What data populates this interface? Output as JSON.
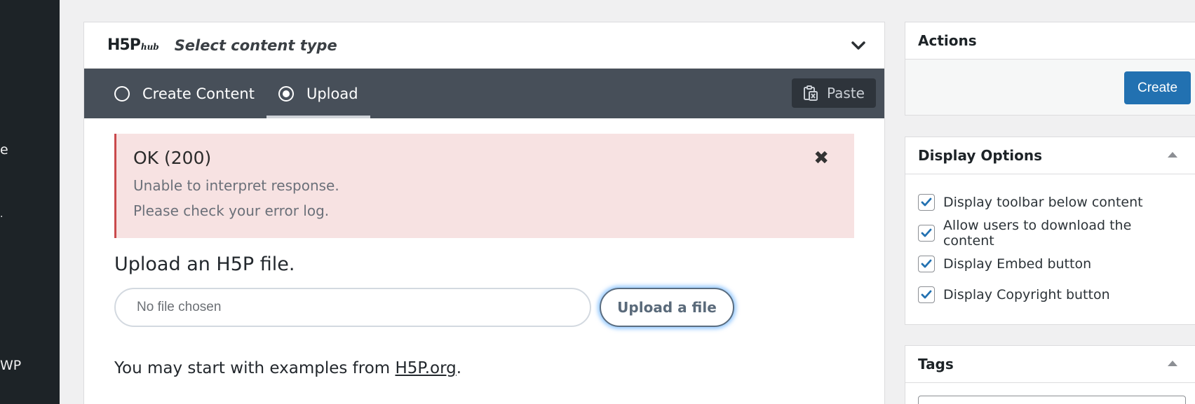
{
  "wp_sidebar": {
    "fragments": [
      "e",
      ".",
      "WP"
    ]
  },
  "hub": {
    "logo_main": "H5P",
    "logo_sub": "hub",
    "title": "Select content type",
    "tabs": [
      {
        "label": "Create Content",
        "selected": false
      },
      {
        "label": "Upload",
        "selected": true
      }
    ],
    "paste_label": "Paste",
    "paste_icon": "clipboard-icon"
  },
  "alert": {
    "title": "OK (200)",
    "lines": [
      "Unable to interpret response.",
      "Please check your error log."
    ],
    "close_icon": "close-icon"
  },
  "upload": {
    "heading": "Upload an H5P file.",
    "file_placeholder": "No file chosen",
    "button_label": "Upload a file",
    "examples_text": "You may start with examples from ",
    "examples_link": "H5P.org",
    "examples_suffix": "."
  },
  "actions_panel": {
    "title": "Actions",
    "create_label": "Create"
  },
  "display_options": {
    "title": "Display Options",
    "options": [
      {
        "label": "Display toolbar below content",
        "checked": true
      },
      {
        "label": "Allow users to download the content",
        "checked": true
      },
      {
        "label": "Display Embed button",
        "checked": true
      },
      {
        "label": "Display Copyright button",
        "checked": true
      }
    ]
  },
  "tags_panel": {
    "title": "Tags"
  },
  "colors": {
    "tabbar_bg": "#474f59",
    "alert_bg": "#f7e2e2",
    "alert_border": "#c9494c",
    "primary_button": "#2271b1",
    "checkbox_check": "#2271b1"
  }
}
